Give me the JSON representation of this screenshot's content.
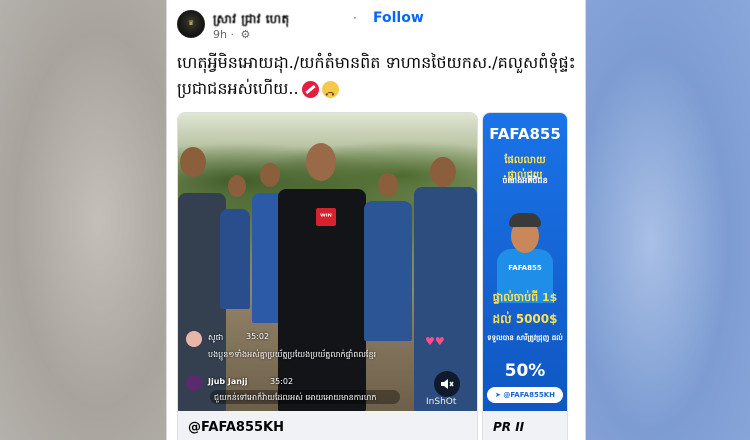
{
  "post": {
    "page_name": "ស្រាវ ជ្រាវ ហេតុ",
    "follow_label": "Follow",
    "time": "9h",
    "separator": "·",
    "caption_line1": "ហេតុអ្វីមិនអោយដុា./យកំតំមានពិត ទាហានថៃយកស./គលួសពំទុំផ្ទះ",
    "caption_line2": "ប្រជាជនអស់ហើយ.."
  },
  "carousel": {
    "slides": [
      {
        "title": "@FAFA855KH",
        "comments": [
          {
            "name": "សូផា",
            "time": "35:02",
            "text": "បងប្អូន១ទាំងអស់គ្នាប្រយ័ត្នប្រយែងប្រយ័ត្នលាក់ផ្ទាំពលខ្មែរ"
          },
          {
            "name": "Jjub Janjj",
            "time": "35:02",
            "text": "ជួយកន់ទៅអេាក៏វ៉ាយដែលអស់ អោយអោយមានការហក"
          }
        ],
        "overlay_badge": "ᵂᴵᴺ",
        "watermark": "InShOt"
      },
      {
        "title": "PR II",
        "ad": {
          "brand": "FAFA855",
          "line1": "ផែលលាយផ្ទាល់ជួយ",
          "line2": "ចំណងអតិថិជន",
          "shirt_label": "FAFA855",
          "deposit": "ផ្ទាល់ចាប់ពី 1$",
          "reward": "ដល់ 5000$",
          "bonus_label": "ទទួលបាន សារីត្រូវជ្រុញ ដល់",
          "bonus_value": "50%",
          "handle": "@FAFA855KH"
        }
      }
    ]
  },
  "colors": {
    "follow": "#0866ff",
    "ad_blue": "#1666d6"
  }
}
